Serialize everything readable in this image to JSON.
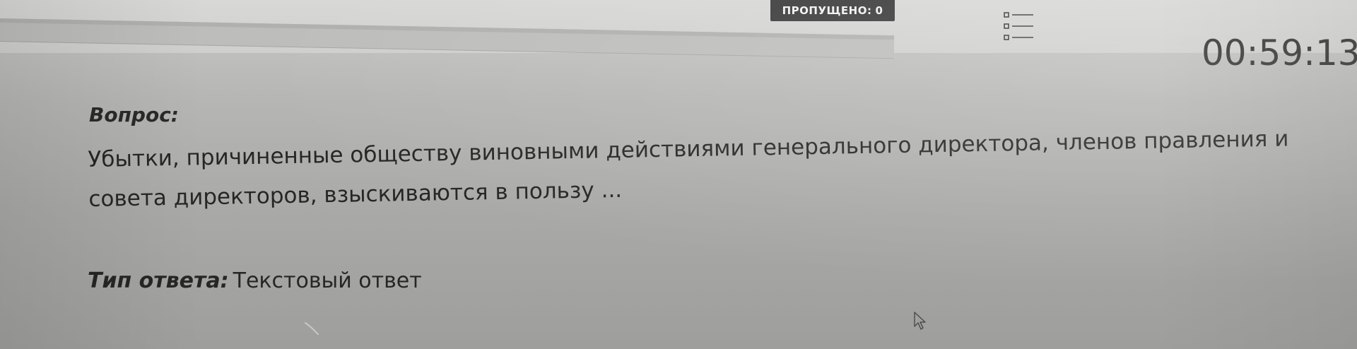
{
  "header": {
    "skipped_label": "ПРОПУЩЕНО:",
    "skipped_count": "0",
    "list_icon": "question-list-icon",
    "timer": "00:59:13"
  },
  "question": {
    "label": "Вопрос:",
    "text": "Убытки, причиненные обществу виновными действиями генерального директора, членов правления и совета директоров, взыскиваются в пользу ..."
  },
  "answer_type": {
    "label": "Тип ответа:",
    "value": "Текстовый ответ"
  },
  "colors": {
    "background": "#b6b6b4",
    "badge": "#3b3b3b",
    "text": "#262626"
  }
}
